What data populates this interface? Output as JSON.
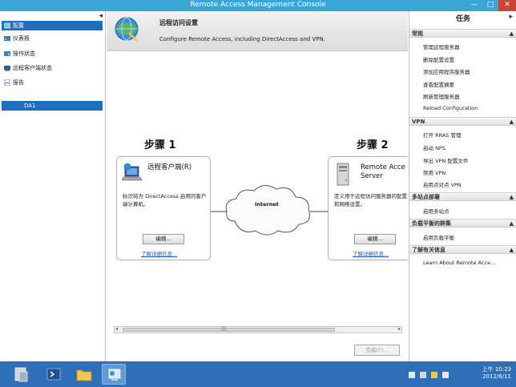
{
  "window": {
    "title": "Remote Access Management Console",
    "min": "—",
    "max": "□",
    "close": "✕"
  },
  "nav": {
    "collapse": "◂",
    "items": [
      {
        "label": "配置",
        "icon": "config-icon"
      },
      {
        "label": "仪表板",
        "icon": "dashboard-icon"
      },
      {
        "label": "操作状态",
        "icon": "operation-status-icon"
      },
      {
        "label": "远程客户端状态",
        "icon": "remote-client-status-icon"
      },
      {
        "label": "报告",
        "icon": "report-icon"
      }
    ],
    "server": "DA1"
  },
  "banner": {
    "title": "远程访问设置",
    "subtitle": "Configure Remote Access, including DirectAccess and VPN."
  },
  "step1": {
    "heading": "步骤 1",
    "title": "远程客户端(R)",
    "desc": "标识将为 DirectAccess 启用的客户端计算机。",
    "edit": "编辑...",
    "more": "了解详细信息..."
  },
  "step2": {
    "heading": "步骤 2",
    "title_line1": "Remote Acce",
    "title_line2": "Server",
    "desc": "定义用于远程访问服务器的配置和网络设置。",
    "edit": "编辑...",
    "more": "了解详细信息..."
  },
  "internet": "Internet",
  "scroll": {
    "left": "◂",
    "right": "▸",
    "mid": "|||"
  },
  "finish": "完成(F)...",
  "tasks": {
    "title": "任务",
    "collapse": "▸",
    "sections": {
      "general": "常规",
      "vpn": "VPN",
      "multisite": "多站点部署",
      "nlb": "负载平衡的群集",
      "info": "了解有关信息"
    },
    "general_items": [
      "管理远程服务器",
      "删除配置设置",
      "添加应用程序服务器",
      "查看配置摘要",
      "刷新管理服务器",
      "Reload Configuration"
    ],
    "vpn_items": [
      "打开 RRAS 管理",
      "启动 NPS",
      "导出 VPN 配置文件",
      "禁用 VPN",
      "启用点对点 VPN"
    ],
    "multisite_items": [
      "启用多站点"
    ],
    "nlb_items": [
      "启用负载平衡"
    ],
    "info_items": [
      "Learn About Remote Acce..."
    ]
  },
  "taskbar": {
    "clock_time": "上午 10:23",
    "clock_date": "2012/6/11"
  },
  "colors": {
    "titlebar": "#3aa6d8",
    "selection": "#1e6fbf",
    "taskbar": "#2f6fb8",
    "link": "#1a5ab8"
  }
}
